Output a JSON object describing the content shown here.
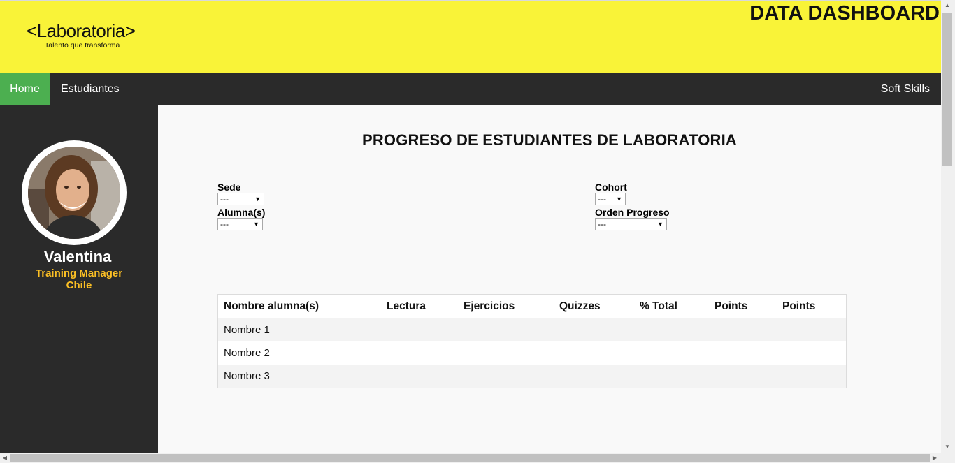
{
  "header": {
    "logo_text": "<Laboratoria>",
    "logo_tagline": "Talento que transforma",
    "title": "DATA DASHBOARD"
  },
  "nav": {
    "home": "Home",
    "students": "Estudiantes",
    "soft_skills": "Soft Skills"
  },
  "sidebar": {
    "name": "Valentina",
    "role": "Training Manager",
    "location": "Chile"
  },
  "main": {
    "title": "PROGRESO DE ESTUDIANTES DE LABORATORIA",
    "filters": {
      "sede_label": "Sede",
      "sede_value": "---",
      "alumnas_label": "Alumna(s)",
      "alumnas_value": "---",
      "cohort_label": "Cohort",
      "cohort_value": "---",
      "orden_label": "Orden Progreso",
      "orden_value": "---"
    },
    "table": {
      "headers": [
        "Nombre alumna(s)",
        "Lectura",
        "Ejercicios",
        "Quizzes",
        "% Total",
        "Points",
        "Points"
      ],
      "rows": [
        [
          "Nombre 1",
          "",
          "",
          "",
          "",
          "",
          ""
        ],
        [
          "Nombre 2",
          "",
          "",
          "",
          "",
          "",
          ""
        ],
        [
          "Nombre 3",
          "",
          "",
          "",
          "",
          "",
          ""
        ]
      ]
    }
  },
  "colors": {
    "header_bg": "#f9f338",
    "nav_bg": "#2a2a2a",
    "active_tab": "#4caf50",
    "role_text": "#fbbf24"
  }
}
